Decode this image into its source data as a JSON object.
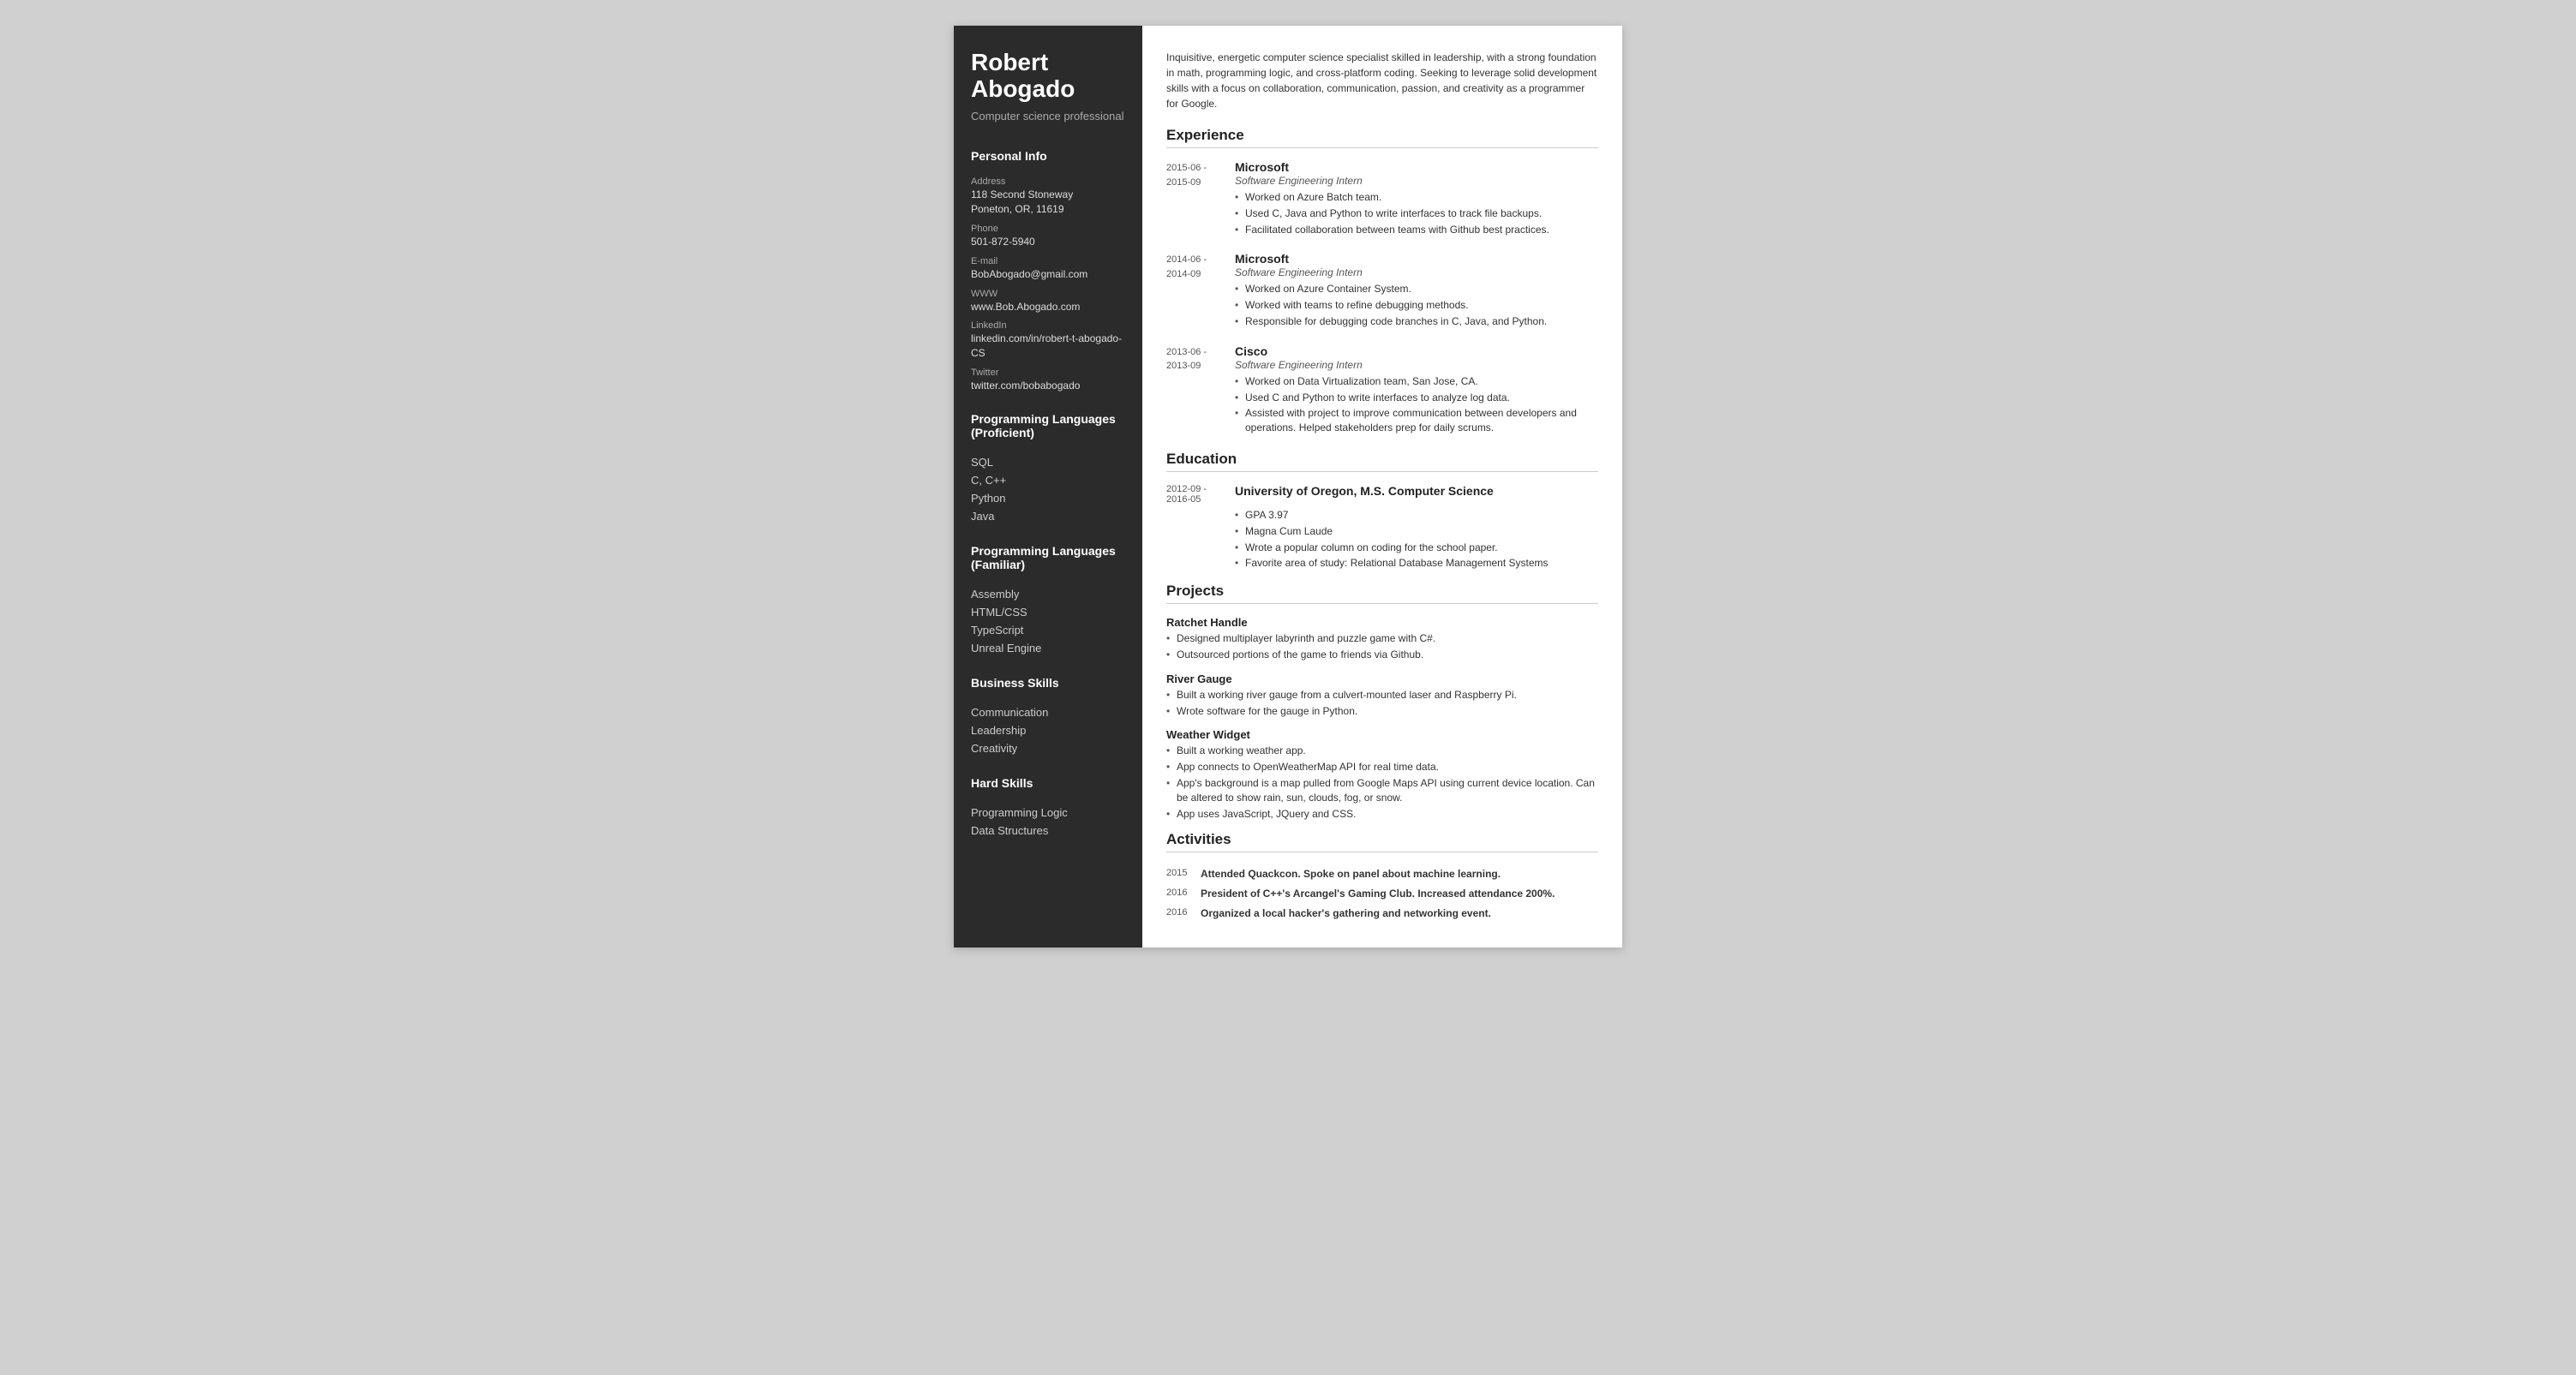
{
  "sidebar": {
    "name": "Robert Abogado",
    "title": "Computer science professional",
    "sections": {
      "personal_info_label": "Personal Info",
      "address_label": "Address",
      "address_value": "118 Second Stoneway\nPoneton, OR, 11619",
      "phone_label": "Phone",
      "phone_value": "501-872-5940",
      "email_label": "E-mail",
      "email_value": "BobAbogado@gmail.com",
      "www_label": "WWW",
      "www_value": "www.Bob.Abogado.com",
      "linkedin_label": "LinkedIn",
      "linkedin_value": "linkedin.com/in/robert-t-abogado-CS",
      "twitter_label": "Twitter",
      "twitter_value": "twitter.com/bobabogado"
    },
    "prog_proficient_label": "Programming Languages (Proficient)",
    "prog_proficient": [
      "SQL",
      "C, C++",
      "Python",
      "Java"
    ],
    "prog_familiar_label": "Programming Languages (Familiar)",
    "prog_familiar": [
      "Assembly",
      "HTML/CSS",
      "TypeScript",
      "Unreal Engine"
    ],
    "business_skills_label": "Business Skills",
    "business_skills": [
      "Communication",
      "Leadership",
      "Creativity"
    ],
    "hard_skills_label": "Hard Skills",
    "hard_skills": [
      "Programming Logic",
      "Data Structures"
    ]
  },
  "main": {
    "summary": "Inquisitive, energetic computer science specialist skilled in leadership, with a strong foundation in math, programming logic, and cross-platform coding. Seeking to leverage solid development skills with a focus on collaboration, communication, passion, and creativity as a programmer for Google.",
    "experience_label": "Experience",
    "experiences": [
      {
        "date": "2015-06 - 2015-09",
        "company": "Microsoft",
        "role": "Software Engineering Intern",
        "bullets": [
          "Worked on Azure Batch team.",
          "Used C, Java and Python to write interfaces to track file backups.",
          "Facilitated collaboration between teams with Github best practices."
        ]
      },
      {
        "date": "2014-06 - 2014-09",
        "company": "Microsoft",
        "role": "Software Engineering Intern",
        "bullets": [
          "Worked on Azure Container System.",
          "Worked with teams to refine debugging methods.",
          "Responsible for debugging code branches in C, Java, and Python."
        ]
      },
      {
        "date": "2013-06 - 2013-09",
        "company": "Cisco",
        "role": "Software Engineering Intern",
        "bullets": [
          "Worked on Data Virtualization team, San Jose, CA.",
          "Used C and Python to write interfaces to analyze log data.",
          "Assisted with project to improve communication between developers and operations. Helped stakeholders prep for daily scrums."
        ]
      }
    ],
    "education_label": "Education",
    "education": [
      {
        "date": "2012-09 - 2016-05",
        "school": "University of Oregon, M.S. Computer Science",
        "bullets": [
          "GPA 3.97",
          "Magna Cum Laude",
          "Wrote a popular column on coding for the school paper.",
          "Favorite area of study: Relational Database Management Systems"
        ]
      }
    ],
    "projects_label": "Projects",
    "projects": [
      {
        "name": "Ratchet Handle",
        "bullets": [
          "Designed multiplayer labyrinth and puzzle game with C#.",
          "Outsourced portions of the game to friends via Github."
        ]
      },
      {
        "name": "River Gauge",
        "bullets": [
          "Built a working river gauge from a culvert-mounted laser and Raspberry Pi.",
          "Wrote software for the gauge in Python."
        ]
      },
      {
        "name": "Weather Widget",
        "bullets": [
          "Built a working weather app.",
          "App connects to OpenWeatherMap API for real time data.",
          "App's background is a map pulled from Google Maps API using current device location. Can be altered to show rain, sun, clouds, fog, or snow.",
          "App uses JavaScript, JQuery and CSS."
        ]
      }
    ],
    "activities_label": "Activities",
    "activities": [
      {
        "year": "2015",
        "text": "Attended Quackcon. Spoke on panel about machine learning."
      },
      {
        "year": "2016",
        "text": "President of C++'s Arcangel's Gaming Club. Increased attendance 200%."
      },
      {
        "year": "2016",
        "text": "Organized a local hacker's gathering and networking event."
      }
    ]
  }
}
